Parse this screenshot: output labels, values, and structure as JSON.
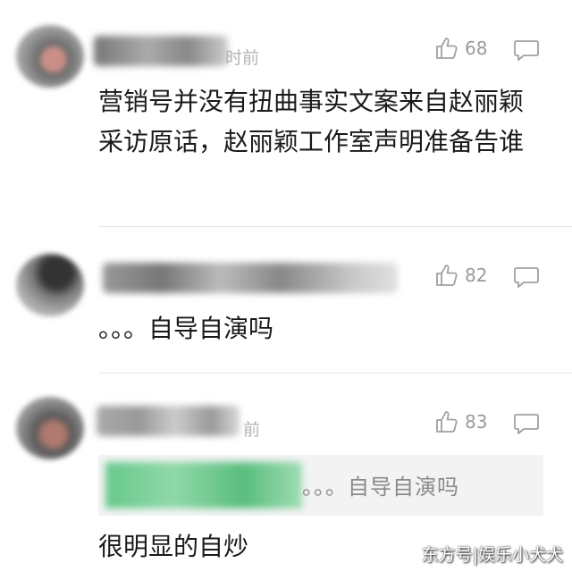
{
  "comments": [
    {
      "time_suffix": "时前",
      "likes": "68",
      "text": "营销号并没有扭曲事实文案来自赵丽颖采访原话，赵丽颖工作室声明准备告谁"
    },
    {
      "likes": "82",
      "text": "。。。自导自演吗"
    },
    {
      "time_suffix": "前",
      "likes": "83",
      "quoted_text": "。。。自导自演吗",
      "text": "很明显的自炒"
    }
  ],
  "watermark": "东方号|娱乐小犬犬",
  "colors": {
    "background": "#ffffff",
    "text": "#1a1a1a",
    "meta": "#9a9a9a",
    "quote_bg": "#f3f3f3"
  },
  "icons": [
    "thumbs-up-icon",
    "reply-bubble-icon"
  ]
}
